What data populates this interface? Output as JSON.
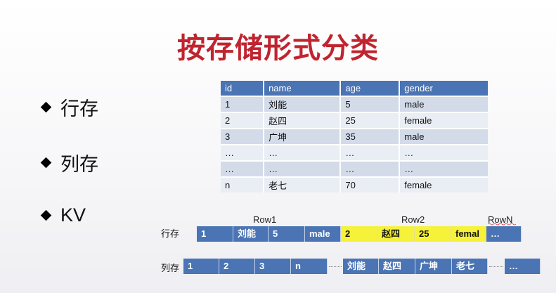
{
  "title": "按存储形式分类",
  "bullets": [
    "行存",
    "列存",
    "KV"
  ],
  "table": {
    "headers": [
      "id",
      "name",
      "age",
      "gender"
    ],
    "rows": [
      [
        "1",
        "刘能",
        "5",
        "male"
      ],
      [
        "2",
        "赵四",
        "25",
        "female"
      ],
      [
        "3",
        "广坤",
        "35",
        "male"
      ],
      [
        "…",
        "…",
        "…",
        "…"
      ],
      [
        "…",
        "…",
        "…",
        "…"
      ],
      [
        "n",
        "老七",
        "70",
        "female"
      ]
    ]
  },
  "diagram": {
    "row_labels": [
      "Row1",
      "Row2",
      "RowN"
    ],
    "row_store_label": "行存",
    "col_store_label": "列存",
    "row_store_cells": [
      "1",
      "刘能",
      "5",
      "male",
      "2",
      "赵四",
      "25",
      "femal",
      "…"
    ],
    "col_store_cells": [
      "1",
      "2",
      "3",
      "n",
      "刘能",
      "赵四",
      "广坤",
      "老七",
      "…"
    ]
  },
  "colors": {
    "title": "#c0242f",
    "blue": "#4a74b4",
    "highlight": "#f6f23a"
  }
}
